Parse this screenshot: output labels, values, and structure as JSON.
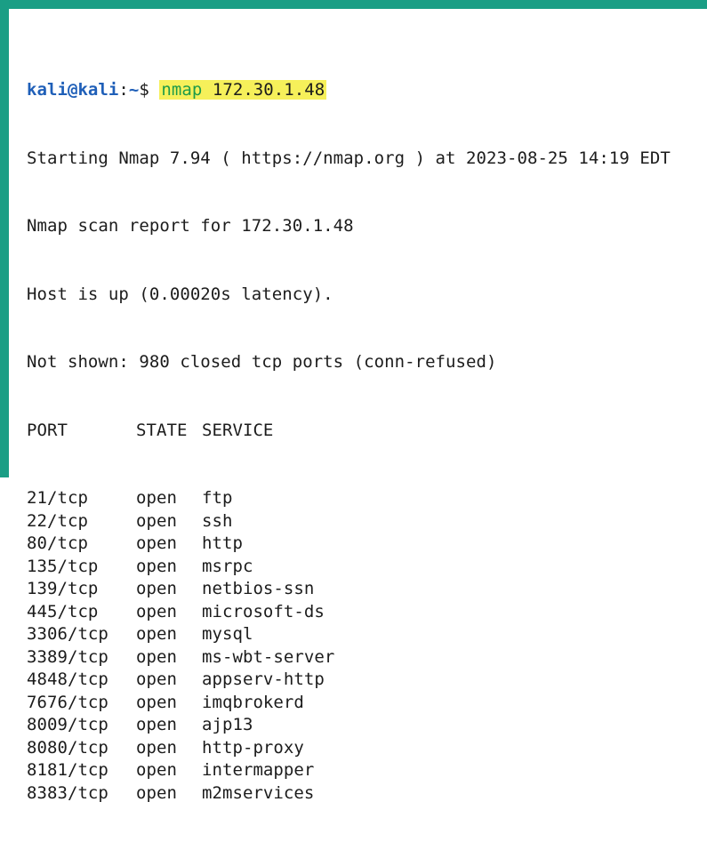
{
  "prompt": {
    "user_host": "kali@kali",
    "colon": ":",
    "path": "~",
    "symbol": "$ ",
    "command": "nmap",
    "argument": " 172.30.1.48"
  },
  "output": {
    "starting": "Starting Nmap 7.94 ( https://nmap.org ) at 2023-08-25 14:19 EDT",
    "report": "Nmap scan report for 172.30.1.48",
    "host_up": "Host is up (0.00020s latency).",
    "not_shown": "Not shown: 980 closed tcp ports (conn-refused)"
  },
  "table": {
    "headers": {
      "port": "PORT",
      "state": "STATE",
      "service": "SERVICE"
    },
    "rows": [
      {
        "port": "21/tcp",
        "state": "open",
        "service": "ftp"
      },
      {
        "port": "22/tcp",
        "state": "open",
        "service": "ssh"
      },
      {
        "port": "80/tcp",
        "state": "open",
        "service": "http"
      },
      {
        "port": "135/tcp",
        "state": "open",
        "service": "msrpc"
      },
      {
        "port": "139/tcp",
        "state": "open",
        "service": "netbios-ssn"
      },
      {
        "port": "445/tcp",
        "state": "open",
        "service": "microsoft-ds"
      },
      {
        "port": "3306/tcp",
        "state": "open",
        "service": "mysql"
      },
      {
        "port": "3389/tcp",
        "state": "open",
        "service": "ms-wbt-server"
      },
      {
        "port": "4848/tcp",
        "state": "open",
        "service": "appserv-http"
      },
      {
        "port": "7676/tcp",
        "state": "open",
        "service": "imqbrokerd"
      },
      {
        "port": "8009/tcp",
        "state": "open",
        "service": "ajp13"
      },
      {
        "port": "8080/tcp",
        "state": "open",
        "service": "http-proxy"
      },
      {
        "port": "8181/tcp",
        "state": "open",
        "service": "intermapper"
      },
      {
        "port": "8383/tcp",
        "state": "open",
        "service": "m2mservices"
      }
    ]
  },
  "colors": {
    "frame": "#1a9e85",
    "prompt_user": "#1f5fb8",
    "command": "#1e9b49",
    "highlight": "#f6f05a",
    "text": "#1c1c1c"
  }
}
